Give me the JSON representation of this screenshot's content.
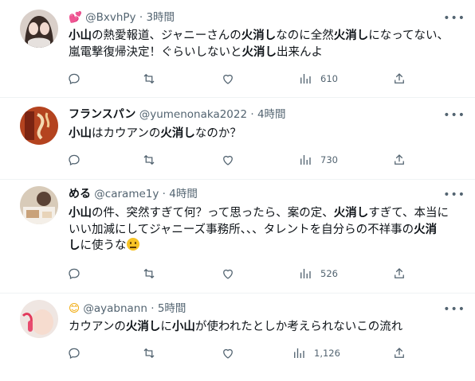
{
  "tweets": [
    {
      "name_prefix": "💕",
      "name": "",
      "handle": "@BxvhPy",
      "dot": "·",
      "time": "3時間",
      "body_html": "<b>小山</b>の熱愛報道、ジャニーさんの<b>火消し</b>なのに全然<b>火消し</b>になってない、<br>嵐電撃復帰決定！ぐらいしないと<b>火消し</b>出来んよ",
      "views": "610"
    },
    {
      "name_prefix": "",
      "name": "フランスパン",
      "handle": "@yumenonaka2022",
      "dot": "·",
      "time": "4時間",
      "body_html": "<b>小山</b>はカウアンの<b>火消し</b>なのか？",
      "views": "730"
    },
    {
      "name_prefix": "",
      "name": "める",
      "handle": "@carame1y",
      "dot": "·",
      "time": "4時間",
      "body_html": "<b>小山</b>の件、突然すぎて何？って思ったら、案の定、<b>火消し</b>すぎて、本当に<br>いい加減にしてジャニーズ事務所、、、タレントを自分らの不祥事の<b>火消</b><br><b>し</b>に使うな<span class=\"emoji\" data-name=\"confused-face-emoji\" data-interactable=\"false\"><i></i></span>",
      "views": "526"
    },
    {
      "name_prefix": "😊",
      "name": "",
      "handle": "@ayabnann",
      "dot": "·",
      "time": "5時間",
      "body_html": "カウアンの<b>火消し</b>に<b>小山</b>が使われたとしか考えられないこの流れ",
      "views": "1,126"
    }
  ],
  "icons": {
    "more": "more-dots-icon",
    "reply": "reply-icon",
    "retweet": "retweet-icon",
    "like": "like-icon",
    "views": "views-icon",
    "share": "share-icon"
  },
  "colors": {
    "text": "#0f1419",
    "muted": "#536471",
    "divider": "#eff3f4"
  }
}
